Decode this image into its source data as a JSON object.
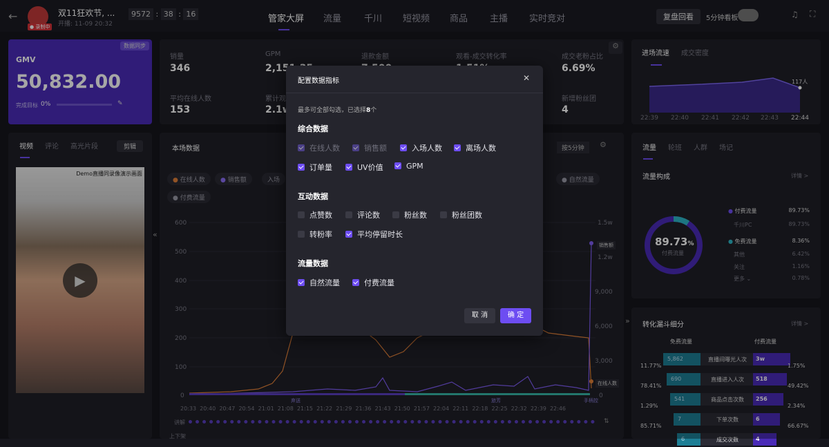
{
  "header": {
    "title": "双11狂欢节, ...",
    "live_badge": "● 录制中",
    "start_time": "开播: 11-09 20:32",
    "timer": [
      "9572",
      "38",
      "16"
    ],
    "tabs": [
      "管家大屏",
      "流量",
      "千川",
      "短视频",
      "商品",
      "主播",
      "实时竞对"
    ],
    "review_btn": "复盘回看",
    "five_min_label": "5分钟看板"
  },
  "gmv": {
    "label": "GMV",
    "tag": "数据同步",
    "value": "50,832.00",
    "target_label": "完成目标",
    "target_value": "0%"
  },
  "metrics": [
    {
      "label": "销量",
      "value": "346"
    },
    {
      "label": "GPM",
      "value": "2,151.35"
    },
    {
      "label": "退款金额",
      "value": "7,500"
    },
    {
      "label": "观看-成交转化率",
      "value": "1.51%"
    },
    {
      "label": "成交老粉占比",
      "value": "6.69%"
    },
    {
      "label": "平均在线人数",
      "value": "153"
    },
    {
      "label": "累计观看",
      "value": "2.1w"
    },
    {
      "label": "",
      "value": ""
    },
    {
      "label": "",
      "value": ""
    },
    {
      "label": "新增粉丝团",
      "value": "4"
    }
  ],
  "left_tabs": [
    "视频",
    "评论",
    "高光片段"
  ],
  "edit_btn": "剪辑",
  "video_caption": "Demo直播同录像演示画面",
  "live_section": {
    "title": "本场数据",
    "interval": "按5分钟",
    "legend": [
      "在线人数",
      "销售额",
      "入场",
      "自然流量",
      "付费流量"
    ],
    "y_left": [
      "600",
      "500",
      "400",
      "300",
      "200",
      "100",
      "0"
    ],
    "y_right": [
      "1.5w",
      "1.2w",
      "9,000",
      "6,000",
      "3,000",
      "0"
    ],
    "x_ticks": [
      "20:33",
      "20:40",
      "20:47",
      "20:54",
      "21:01",
      "21:08",
      "21:15",
      "21:22",
      "21:29",
      "21:36",
      "21:43",
      "21:50",
      "21:57",
      "22:04",
      "22:11",
      "22:18",
      "22:25",
      "22:32",
      "22:39",
      "22:46"
    ],
    "phase_labels": [
      "弃送",
      "旅芳",
      "手柄控"
    ],
    "end_labels": [
      "销售额",
      "在线人数"
    ],
    "row_label_1": "讲解",
    "row_label_2": "上下架"
  },
  "flow_panel": {
    "tabs": [
      "进场流速",
      "成交密度"
    ],
    "peak": "117人",
    "x_ticks": [
      "22:39",
      "22:40",
      "22:41",
      "22:42",
      "22:43",
      "22:44"
    ]
  },
  "traffic": {
    "tabs": [
      "流量",
      "轮班",
      "人群",
      "场记"
    ],
    "structure_title": "流量构成",
    "detail": "详情 >",
    "donut_value": "89.73",
    "donut_pct": "%",
    "donut_label": "付费流量",
    "rows": [
      {
        "label": "付费流量",
        "value": "89.73%",
        "strong": true
      },
      {
        "label": "千川PC",
        "value": "89.73%"
      },
      {
        "label": "免费流量",
        "value": "8.36%",
        "strong": true
      },
      {
        "label": "其他",
        "value": "6.42%"
      },
      {
        "label": "关注",
        "value": "1.16%"
      },
      {
        "label": "更多 ⌄",
        "value": "0.78%"
      }
    ]
  },
  "funnel": {
    "title": "转化漏斗细分",
    "detail": "详情 >",
    "free_label": "免费流量",
    "paid_label": "付费流量",
    "stages": [
      {
        "name": "直播间曝光人次",
        "free": "5,862",
        "paid": "3w",
        "l": "11.77%",
        "r": "1.75%"
      },
      {
        "name": "直播进入人次",
        "free": "690",
        "paid": "518",
        "l": "78.41%",
        "r": "49.42%"
      },
      {
        "name": "商品点击次数",
        "free": "541",
        "paid": "256",
        "l": "1.29%",
        "r": "2.34%"
      },
      {
        "name": "下单次数",
        "free": "7",
        "paid": "6",
        "l": "85.71%",
        "r": "66.67%"
      },
      {
        "name": "成交次数",
        "free": "6",
        "paid": "4",
        "l": "",
        "r": ""
      }
    ]
  },
  "modal": {
    "title": "配置数据指标",
    "hint_prefix": "最多可全部勾选，已选择",
    "hint_count": "8",
    "hint_suffix": "个",
    "sections": [
      {
        "title": "综合数据",
        "items": [
          "在线人数",
          "销售额",
          "入场人数",
          "离场人数",
          "订单量",
          "UV价值",
          "GPM"
        ]
      },
      {
        "title": "互动数据",
        "items": [
          "点赞数",
          "评论数",
          "粉丝数",
          "粉丝团数",
          "转粉率",
          "平均停留时长"
        ]
      },
      {
        "title": "流量数据",
        "items": [
          "自然流量",
          "付费流量"
        ]
      }
    ],
    "cancel": "取 消",
    "confirm": "确 定"
  },
  "colors": {
    "accent": "#6d4df2",
    "gmv_bg": "#4a2bb8",
    "orange": "#e0803a",
    "teal": "#37b6a6"
  }
}
